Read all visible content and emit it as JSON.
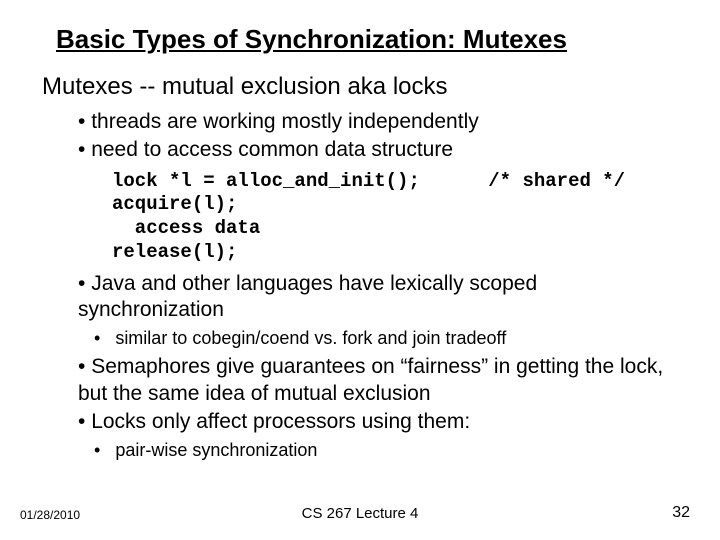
{
  "title": "Basic Types of Synchronization: Mutexes",
  "subtitle": "Mutexes -- mutual exclusion aka locks",
  "bullets1": {
    "a": "threads are working mostly independently",
    "b": "need to access common data structure"
  },
  "code": "lock *l = alloc_and_init();      /* shared */\nacquire(l);\n  access data\nrelease(l);",
  "bullets2": {
    "a": "Java and other languages have lexically scoped synchronization"
  },
  "sub2": {
    "a": "similar to cobegin/coend vs. fork and join tradeoff"
  },
  "bullets3": {
    "a": "Semaphores give guarantees on “fairness” in getting the lock, but the same idea of mutual exclusion",
    "b": "Locks only affect processors using them:"
  },
  "sub3": {
    "a": "pair-wise synchronization"
  },
  "footer": {
    "date": "01/28/2010",
    "center": "CS 267 Lecture 4",
    "page": "32"
  }
}
